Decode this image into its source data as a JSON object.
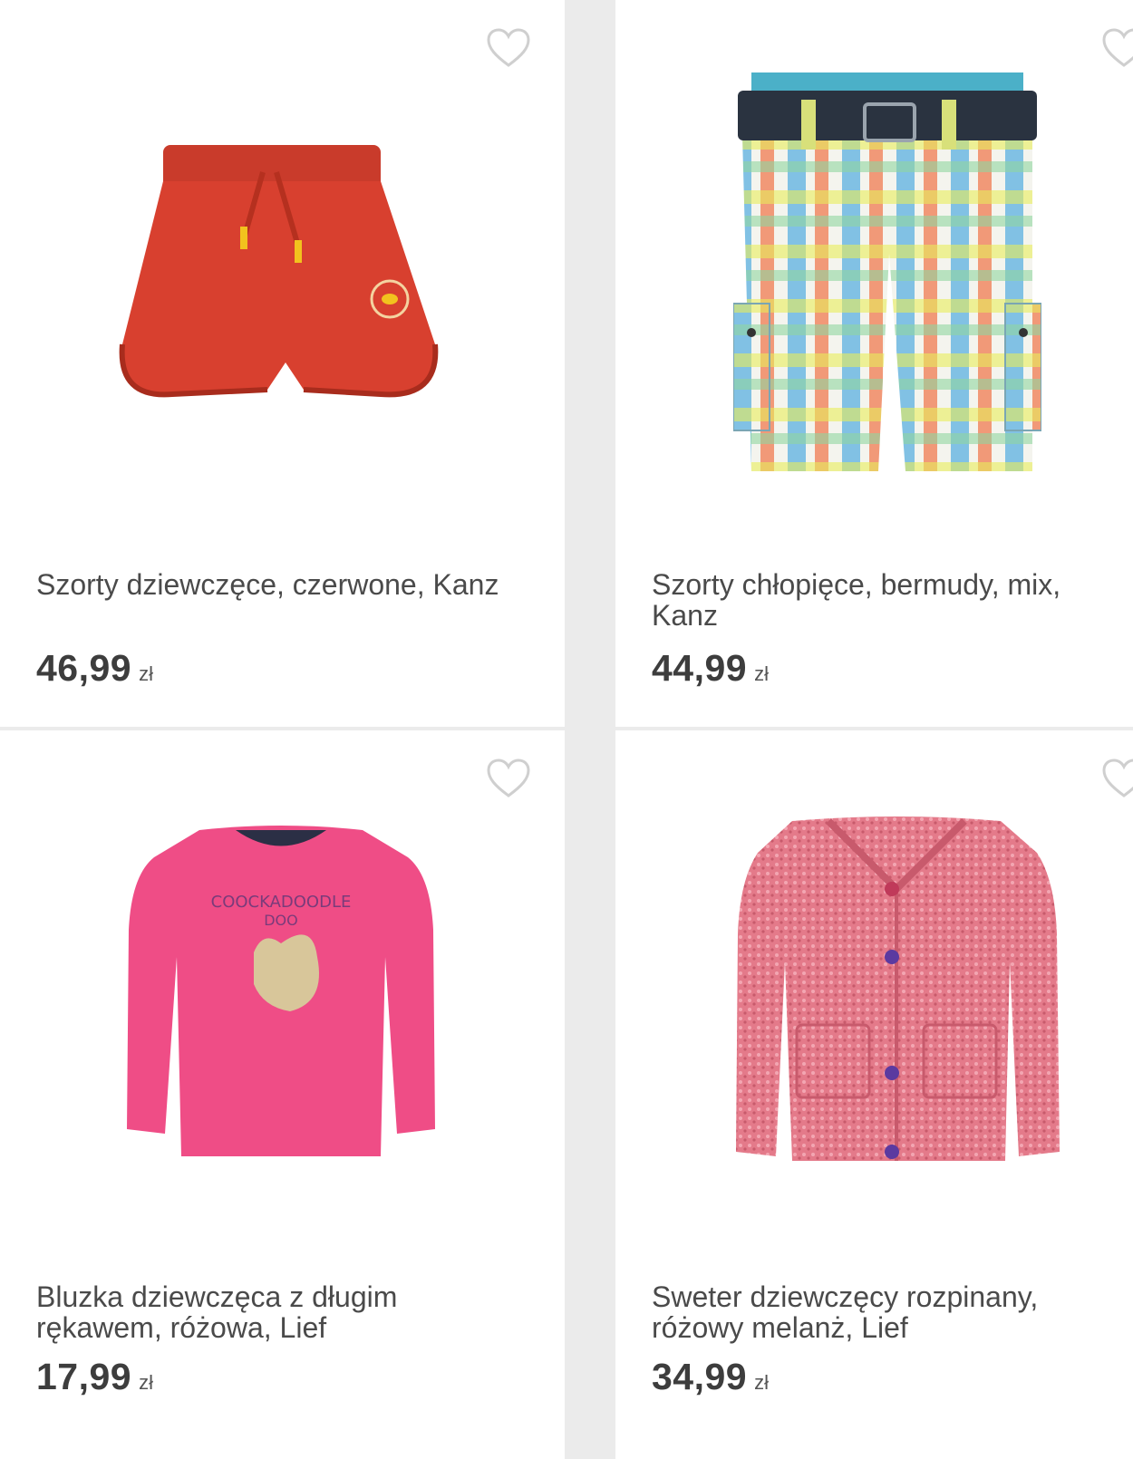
{
  "products": [
    {
      "title": "Szorty dziewczęce, czerwone, Kanz",
      "price": "46,99",
      "currency": "zł",
      "image_icon": "red-shorts-image",
      "colors": {
        "main": "#d83f30",
        "dark": "#b8301f",
        "accent": "#f2c21e"
      }
    },
    {
      "title": "Szorty chłopięce, bermudy, mix, Kanz",
      "price": "44,99",
      "currency": "zł",
      "image_icon": "plaid-bermuda-shorts-image",
      "colors": {
        "belt": "#2a3340",
        "blue": "#5ab0e0",
        "orange": "#f07a50",
        "yellow": "#e8ec5a",
        "green": "#8fd6a0"
      }
    },
    {
      "title": "Bluzka dziewczęca z długim rękawem, różowa, Lief",
      "price": "17,99",
      "currency": "zł",
      "image_icon": "pink-long-sleeve-top-image",
      "colors": {
        "main": "#ef4d86",
        "print": "#d8c69a",
        "text": "#7a3b7a"
      }
    },
    {
      "title": "Sweter dziewczęcy rozpinany, różowy melanż, Lief",
      "price": "34,99",
      "currency": "zł",
      "image_icon": "pink-cardigan-image",
      "colors": {
        "main": "#e47a8a",
        "light": "#f3a6b2",
        "button": "#5b3aa0"
      }
    }
  ]
}
